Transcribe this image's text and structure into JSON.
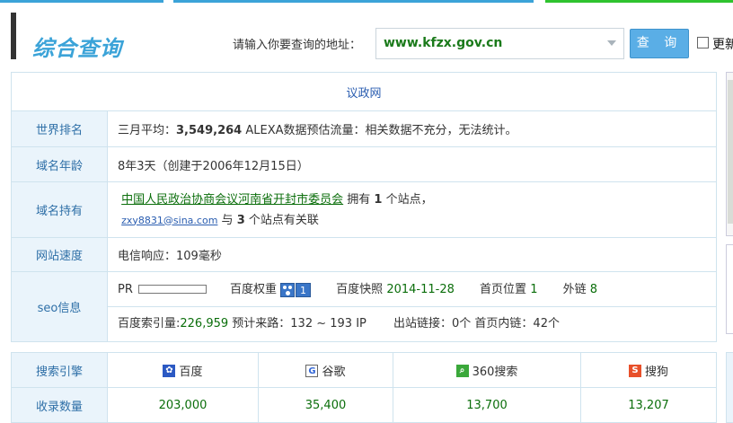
{
  "colors": {
    "accent": "#3ba3d8",
    "label_bg": "#eaf4fb",
    "value_green": "#0b6e0b",
    "link_blue": "#2a5db0",
    "button": "#5aaee6",
    "top_strip_blue": "#3ba3d8",
    "top_strip_green": "#2fc32f"
  },
  "header": {
    "title": "综合查询",
    "prompt": "请输入你要查询的地址：",
    "url_value": "www.kfzx.gov.cn",
    "query_button": "查 询",
    "checkbox_label": "更新"
  },
  "info": {
    "site_name": "议政网",
    "rows": {
      "world_rank": {
        "label": "世界排名",
        "prefix": "三月平均：",
        "rank": "3,549,264",
        "suffix": "  ALEXA数据预估流量：相关数据不充分，无法统计。"
      },
      "domain_age": {
        "label": "域名年龄",
        "text": "8年3天（创建于2006年12月15日）"
      },
      "domain_owner": {
        "label": "域名持有",
        "owner": "中国人民政治协商会议河南省开封市委员会",
        "has_text": " 拥有 ",
        "site_count": "1",
        "sites_suffix": " 个站点，",
        "email": "zxy8831@sina.com",
        "and_text": " 与 ",
        "related_count": "3",
        "related_suffix": " 个站点有关联"
      },
      "speed": {
        "label": "网站速度",
        "text": "电信响应：109毫秒"
      },
      "seo": {
        "label": "seo信息",
        "pr_label": "PR",
        "baidu_weight_label": "百度权重",
        "baidu_weight_value": "1",
        "snapshot_label": "百度快照",
        "snapshot_value": "2014-11-28",
        "home_pos_label": "首页位置",
        "home_pos_value": "1",
        "external_label": "外链",
        "external_value": "8",
        "index_label": "百度索引量:",
        "index_value": "226,959",
        "traffic_text": "  预计来路：132 ~ 193 IP",
        "outlinks_text": "出站链接：0个 首页内链：42个"
      }
    }
  },
  "engines": {
    "header_label": "搜索引擎",
    "count_label": "收录数量",
    "items": [
      {
        "name": "百度",
        "icon": "baidu-paw-icon",
        "count": "203,000"
      },
      {
        "name": "谷歌",
        "icon": "google-g-icon",
        "count": "35,400"
      },
      {
        "name": "360搜索",
        "icon": "search-360-icon",
        "count": "13,700"
      },
      {
        "name": "搜狗",
        "icon": "sogou-s-icon",
        "count": "13,207"
      }
    ]
  }
}
